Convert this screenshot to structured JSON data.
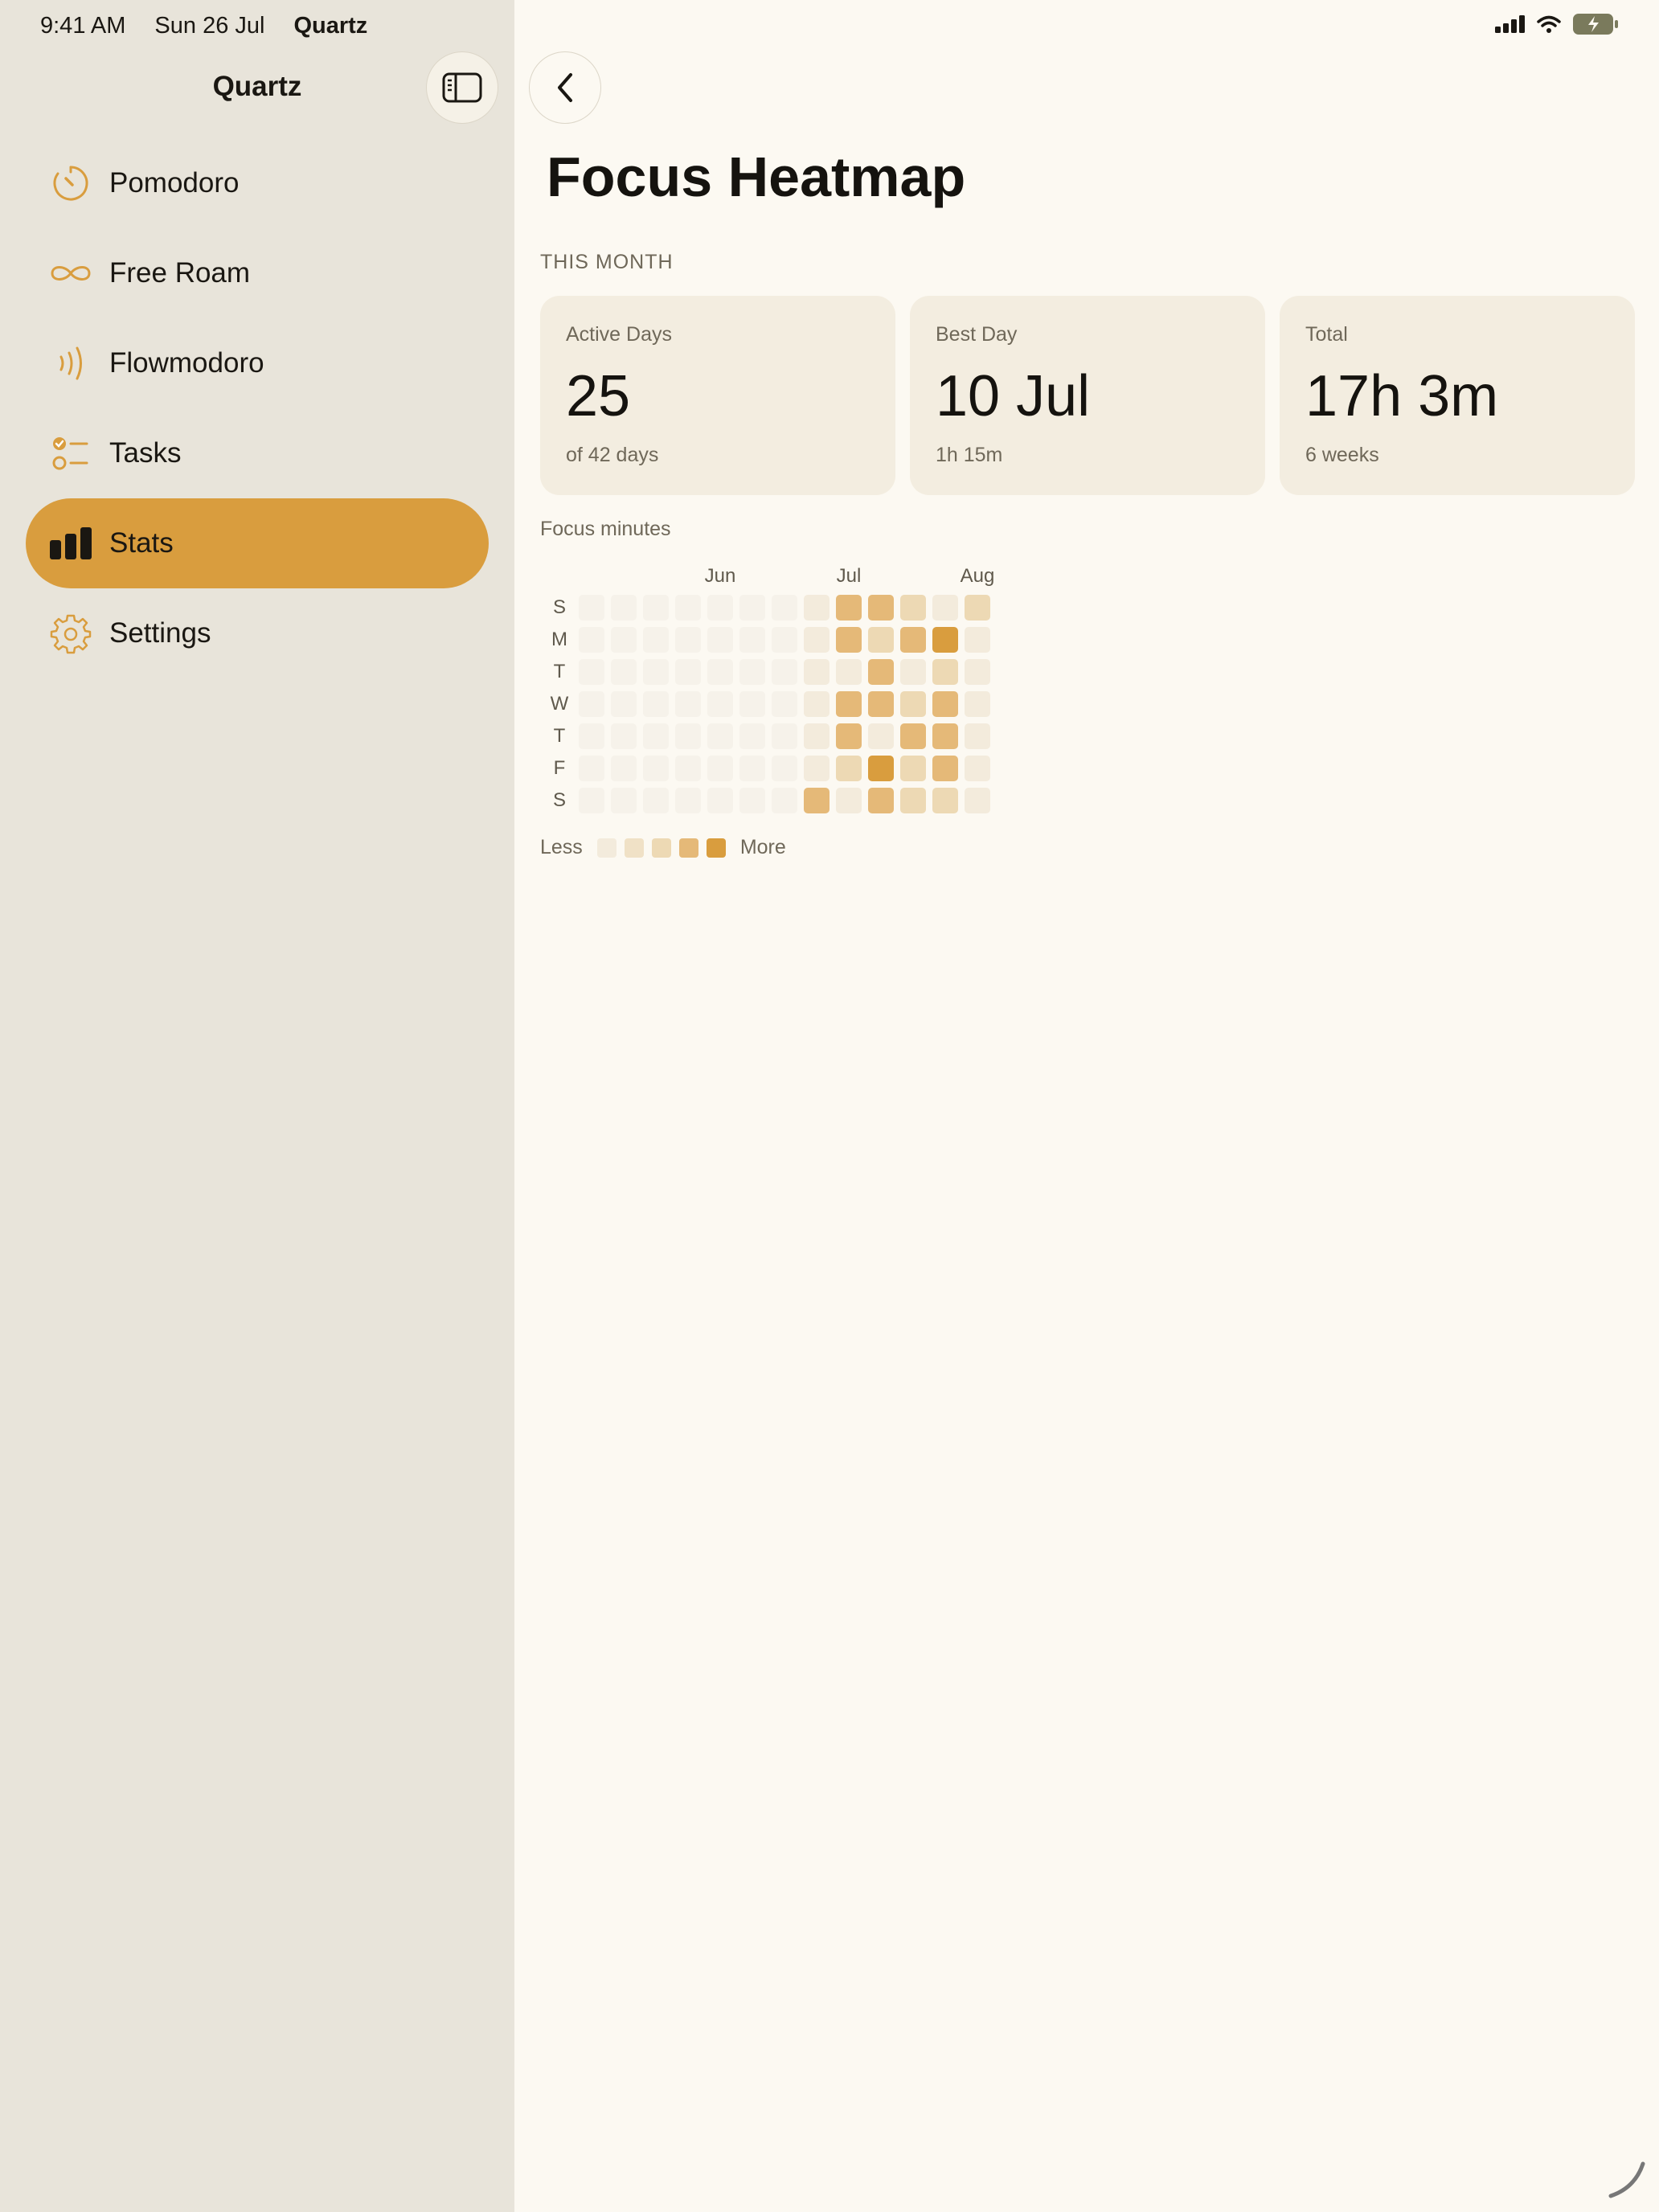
{
  "status_bar": {
    "time": "9:41 AM",
    "date": "Sun 26 Jul",
    "app": "Quartz"
  },
  "sidebar": {
    "title": "Quartz",
    "toggle_icon": "sidebar-toggle-icon",
    "items": [
      {
        "label": "Pomodoro",
        "icon": "timer-icon",
        "active": false
      },
      {
        "label": "Free Roam",
        "icon": "infinity-icon",
        "active": false
      },
      {
        "label": "Flowmodoro",
        "icon": "wave-icon",
        "active": false
      },
      {
        "label": "Tasks",
        "icon": "checklist-icon",
        "active": false
      },
      {
        "label": "Stats",
        "icon": "bar-chart-icon",
        "active": true
      },
      {
        "label": "Settings",
        "icon": "gear-icon",
        "active": false
      }
    ]
  },
  "main": {
    "title": "Focus Heatmap",
    "section_label": "THIS MONTH",
    "cards": [
      {
        "label": "Active Days",
        "value": "25",
        "sub": "of 42 days"
      },
      {
        "label": "Best Day",
        "value": "10 Jul",
        "sub": "1h 15m"
      },
      {
        "label": "Total",
        "value": "17h 3m",
        "sub": "6 weeks"
      }
    ],
    "chart_label": "Focus minutes",
    "legend": {
      "less": "Less",
      "more": "More"
    }
  },
  "colors": {
    "accent": "#d99d3e",
    "sidebar_bg": "#e8e4da",
    "main_bg": "#fcf9f2",
    "card_bg": "#f3ede0",
    "levels": [
      "#f6f2ea",
      "#f3ebdc",
      "#edd9b4",
      "#e5b978",
      "#d99d3e"
    ]
  },
  "chart_data": {
    "type": "heatmap",
    "month_labels": [
      "Jun",
      "Jul",
      "Aug"
    ],
    "month_label_columns": [
      4,
      8,
      12
    ],
    "day_labels": [
      "S",
      "M",
      "T",
      "W",
      "T",
      "F",
      "S"
    ],
    "columns": 13,
    "levels": [
      [
        0,
        0,
        0,
        0,
        0,
        0,
        0,
        1,
        3,
        3,
        2,
        1,
        2
      ],
      [
        0,
        0,
        0,
        0,
        0,
        0,
        0,
        1,
        3,
        2,
        3,
        4,
        1
      ],
      [
        0,
        0,
        0,
        0,
        0,
        0,
        0,
        1,
        1,
        3,
        1,
        2,
        1
      ],
      [
        0,
        0,
        0,
        0,
        0,
        0,
        0,
        1,
        3,
        3,
        2,
        3,
        1
      ],
      [
        0,
        0,
        0,
        0,
        0,
        0,
        0,
        1,
        3,
        1,
        3,
        3,
        1
      ],
      [
        0,
        0,
        0,
        0,
        0,
        0,
        0,
        1,
        2,
        4,
        2,
        3,
        1
      ],
      [
        0,
        0,
        0,
        0,
        0,
        0,
        0,
        3,
        1,
        3,
        2,
        2,
        1
      ]
    ]
  }
}
